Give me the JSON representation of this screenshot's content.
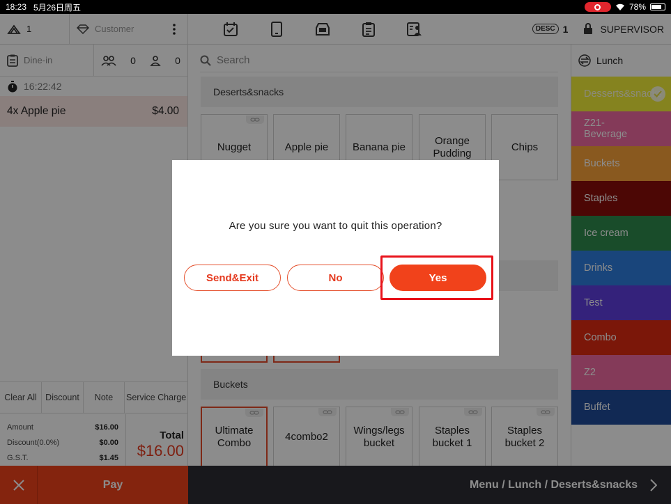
{
  "status_bar": {
    "time": "18:23",
    "date": "5月26日周五",
    "battery_percent": "78%",
    "battery_level": 0.78
  },
  "top_bar": {
    "people_count": "1",
    "customer_label": "Customer",
    "desc_badge": "DESC",
    "desc_count": "1",
    "user_label": "SUPERVISOR"
  },
  "order": {
    "type": "Dine-in",
    "adults": "0",
    "children": "0",
    "timer": "16:22:42",
    "items": [
      {
        "label": "4x Apple pie",
        "price": "$4.00"
      }
    ]
  },
  "functions": {
    "clear_all": "Clear All",
    "discount": "Discount",
    "note": "Note",
    "service_charge": "Service Charge"
  },
  "totals": {
    "amount_label": "Amount",
    "amount": "$16.00",
    "discount_label": "Discount(0.0%)",
    "discount": "$0.00",
    "gst_label": "G.S.T.",
    "gst": "$1.45",
    "total_label": "Total",
    "total": "$16.00"
  },
  "bottom": {
    "pay_label": "Pay",
    "breadcrumb": "Menu / Lunch / Deserts&snacks"
  },
  "menu": {
    "search_placeholder": "Search",
    "section1": "Deserts&snacks",
    "section1_items": [
      "Nugget",
      "Apple pie",
      "Banana pie",
      "Orange Pudding",
      "Chips"
    ],
    "section2": "Buckets",
    "section2_items": [
      "Ultimate Combo",
      "4combo2",
      "Wings/legs bucket",
      "Staples bucket 1",
      "Staples bucket 2"
    ]
  },
  "categories": {
    "header": "Lunch",
    "items": [
      {
        "label": "Desserts&snacks",
        "color": "#f2ee3a"
      },
      {
        "label": "Z21-Beverage",
        "color": "#f06ba2"
      },
      {
        "label": "Buckets",
        "color": "#f9a23a"
      },
      {
        "label": "Staples",
        "color": "#8b0e0a"
      },
      {
        "label": "Ice cream",
        "color": "#2e8a4e"
      },
      {
        "label": "Drinks",
        "color": "#2f7fe0"
      },
      {
        "label": "Test",
        "color": "#5f3ee0"
      },
      {
        "label": "Combo",
        "color": "#e12b12"
      },
      {
        "label": "Z2",
        "color": "#f06ba2"
      },
      {
        "label": "Buffet",
        "color": "#1f4c9a"
      }
    ]
  },
  "dialog": {
    "message": "Are you sure you want to quit this operation?",
    "send_exit": "Send&Exit",
    "no": "No",
    "yes": "Yes"
  },
  "colors": {
    "accent": "#f1421b",
    "highlight": "#e8131b"
  }
}
